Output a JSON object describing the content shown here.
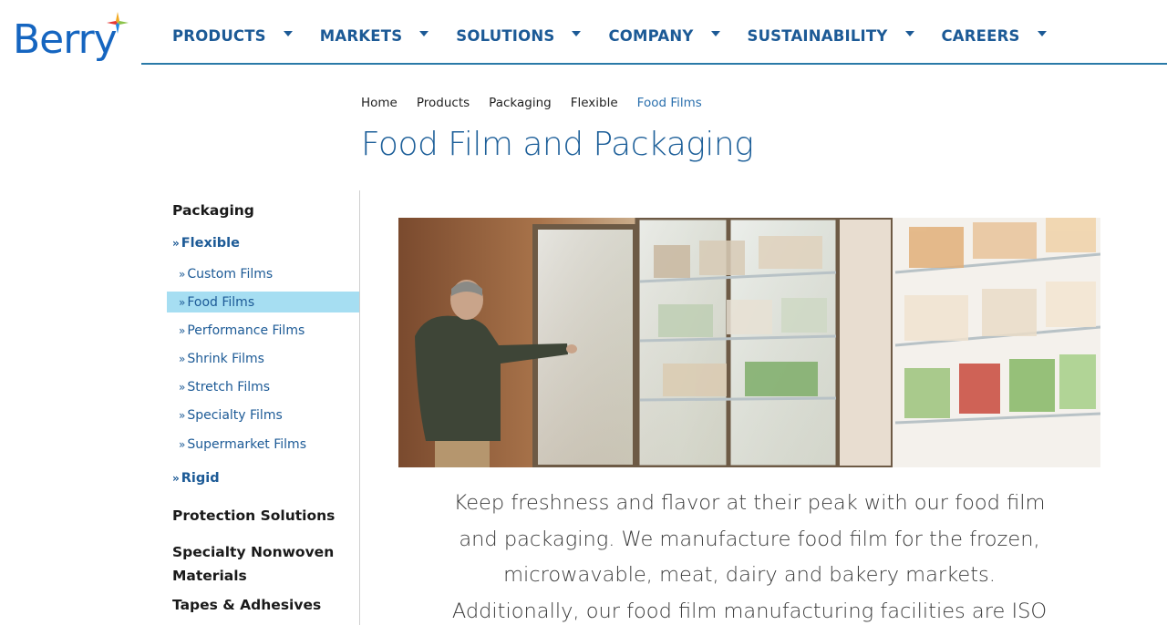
{
  "brand": {
    "name": "Berry",
    "color": "#1565c0",
    "mark_colors": [
      "#f2a922",
      "#8bc34a",
      "#1e88e5",
      "#e53935"
    ]
  },
  "nav": {
    "items": [
      {
        "label": "PRODUCTS",
        "icon": "caret-down-icon"
      },
      {
        "label": "MARKETS",
        "icon": "caret-down-icon"
      },
      {
        "label": "SOLUTIONS",
        "icon": "caret-down-icon"
      },
      {
        "label": "COMPANY",
        "icon": "caret-down-icon"
      },
      {
        "label": "SUSTAINABILITY",
        "icon": "caret-down-icon"
      },
      {
        "label": "CAREERS",
        "icon": "caret-down-icon"
      }
    ]
  },
  "breadcrumb": [
    "Home",
    "Products",
    "Packaging",
    "Flexible",
    "Food Films"
  ],
  "page": {
    "title": "Food Film and Packaging"
  },
  "sidebar": {
    "packaging": "Packaging",
    "flexible": "Flexible",
    "flexible_items": [
      "Custom Films",
      "Food Films",
      "Performance Films",
      "Shrink Films",
      "Stretch Films",
      "Specialty Films",
      "Supermarket Films"
    ],
    "active_item": "Food Films",
    "rigid": "Rigid",
    "protection": "Protection Solutions",
    "nonwoven_line1": "Specialty Nonwoven",
    "nonwoven_line2": "Materials",
    "tapes": "Tapes & Adhesives",
    "chevron": "»"
  },
  "hero": {
    "icon": "grocery-freezer-photo"
  },
  "intro": {
    "line1": "Keep freshness and flavor at their peak with our food film",
    "line2": "and packaging. We manufacture food film for the frozen,",
    "line3": "microwavable, meat, dairy and bakery markets.",
    "line4": "Additionally, our food film manufacturing facilities are ISO"
  },
  "colors": {
    "accent": "#1c5a96",
    "title": "#1d5f99",
    "active_bg": "#a6def2",
    "rule": "#2a7aa8"
  }
}
